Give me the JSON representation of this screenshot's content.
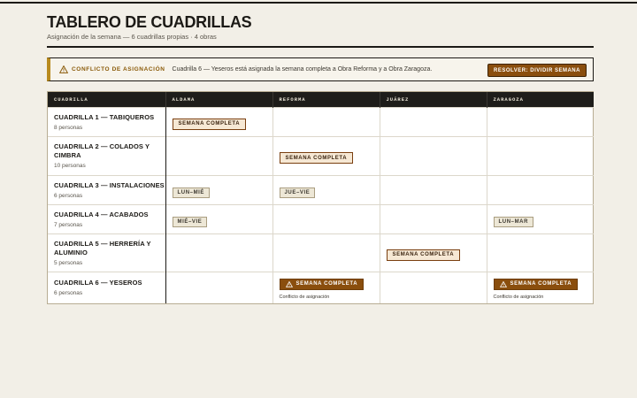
{
  "header": {
    "title": "TABLERO DE CUADRILLAS",
    "subtitle": "Asignación de la semana — 6 cuadrillas propias · 4 obras"
  },
  "alert": {
    "title": "CONFLICTO DE ASIGNACIÓN",
    "message": "Cuadrilla 6 — Yeseros está asignada la semana completa a Obra Reforma y a Obra Zaragoza.",
    "action": "RESOLVER: DIVIDIR SEMANA",
    "icon": "warning-triangle-icon"
  },
  "table": {
    "columns": [
      "CUADRILLA",
      "ALDAMA",
      "REFORMA",
      "JUÁREZ",
      "ZARAGOZA"
    ],
    "rows": [
      {
        "name": "CUADRILLA 1 — TABIQUEROS",
        "size": "8 personas",
        "cells": [
          {
            "label": "SEMANA COMPLETA",
            "kind": "full"
          },
          null,
          null,
          null
        ]
      },
      {
        "name": "CUADRILLA 2 — COLADOS Y CIMBRA",
        "size": "10 personas",
        "cells": [
          null,
          {
            "label": "SEMANA COMPLETA",
            "kind": "full"
          },
          null,
          null
        ]
      },
      {
        "name": "CUADRILLA 3 — INSTALACIONES",
        "size": "6 personas",
        "cells": [
          {
            "label": "LUN–MIÉ",
            "kind": "partial"
          },
          {
            "label": "JUE–VIE",
            "kind": "partial"
          },
          null,
          null
        ]
      },
      {
        "name": "CUADRILLA 4 — ACABADOS",
        "size": "7 personas",
        "cells": [
          {
            "label": "MIÉ–VIE",
            "kind": "partial"
          },
          null,
          null,
          {
            "label": "LUN–MAR",
            "kind": "partial"
          }
        ]
      },
      {
        "name": "CUADRILLA 5 — HERRERÍA Y ALUMINIO",
        "size": "5 personas",
        "cells": [
          null,
          null,
          {
            "label": "SEMANA COMPLETA",
            "kind": "full"
          },
          null
        ]
      },
      {
        "name": "CUADRILLA 6 — YESEROS",
        "size": "6 personas",
        "cells": [
          null,
          {
            "label": "SEMANA COMPLETA",
            "kind": "conflict",
            "note": "Conflicto de asignación"
          },
          null,
          {
            "label": "SEMANA COMPLETA",
            "kind": "conflict",
            "note": "Conflicto de asignación"
          }
        ]
      }
    ]
  },
  "colors": {
    "accent": "#8a4e0d",
    "warning": "#b88a1e",
    "header_bg": "#1e1d1a",
    "page_bg": "#f2efe7"
  }
}
